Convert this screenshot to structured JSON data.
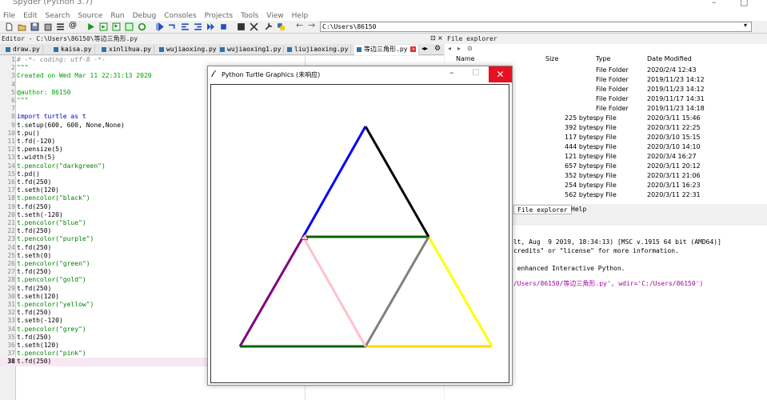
{
  "window": {
    "title": "Spyder (Python 3.7)"
  },
  "menu": [
    "File",
    "Edit",
    "Search",
    "Source",
    "Run",
    "Debug",
    "Consoles",
    "Projects",
    "Tools",
    "View",
    "Help"
  ],
  "toolbar": {
    "path": "C:\\Users\\86150"
  },
  "editor": {
    "pane_title": "Editor - C:\\Users\\86150\\等边三角形.py",
    "tabs": [
      "draw.py",
      "kaisa.py",
      "xinlihua.py",
      "wujiaoxing.py",
      "wujiaoxing1.py",
      "liujiaoxing.py",
      "等边三角形.py"
    ],
    "lines": [
      {
        "n": "1",
        "t": "# -*- coding: utf-8 -*-",
        "k": "comment"
      },
      {
        "n": "2",
        "t": "\"\"\"",
        "k": "doc"
      },
      {
        "n": "3",
        "t": "Created on Wed Mar 11 22:31:13 2020",
        "k": "doc"
      },
      {
        "n": "4",
        "t": "",
        "k": "doc"
      },
      {
        "n": "5",
        "t": "@author: 86150",
        "k": "doc"
      },
      {
        "n": "6",
        "t": "\"\"\"",
        "k": "doc"
      },
      {
        "n": "7",
        "t": "",
        "k": "def"
      },
      {
        "n": "8",
        "t": "import turtle as t",
        "k": "kw"
      },
      {
        "n": "9",
        "t": "t.setup(600, 600, None,None)",
        "k": "def"
      },
      {
        "n": "10",
        "t": "t.pu()",
        "k": "def"
      },
      {
        "n": "11",
        "t": "t.fd(-120)",
        "k": "def"
      },
      {
        "n": "12",
        "t": "t.pensize(5)",
        "k": "def"
      },
      {
        "n": "13",
        "t": "t.width(5)",
        "k": "def"
      },
      {
        "n": "14",
        "t": "t.pencolor(\"darkgreen\")",
        "k": "str"
      },
      {
        "n": "15",
        "t": "t.pd()",
        "k": "def"
      },
      {
        "n": "16",
        "t": "t.fd(250)",
        "k": "def"
      },
      {
        "n": "17",
        "t": "t.seth(120)",
        "k": "def"
      },
      {
        "n": "18",
        "t": "t.pencolor(\"black\")",
        "k": "str"
      },
      {
        "n": "19",
        "t": "t.fd(250)",
        "k": "def"
      },
      {
        "n": "20",
        "t": "t.seth(-120)",
        "k": "def"
      },
      {
        "n": "21",
        "t": "t.pencolor(\"blue\")",
        "k": "str"
      },
      {
        "n": "22",
        "t": "t.fd(250)",
        "k": "def"
      },
      {
        "n": "23",
        "t": "t.pencolor(\"purple\")",
        "k": "str"
      },
      {
        "n": "24",
        "t": "t.fd(250)",
        "k": "def"
      },
      {
        "n": "25",
        "t": "t.seth(0)",
        "k": "def"
      },
      {
        "n": "26",
        "t": "t.pencolor(\"green\")",
        "k": "str"
      },
      {
        "n": "27",
        "t": "t.fd(250)",
        "k": "def"
      },
      {
        "n": "28",
        "t": "t.pencolor(\"gold\")",
        "k": "str"
      },
      {
        "n": "29",
        "t": "t.fd(250)",
        "k": "def"
      },
      {
        "n": "30",
        "t": "t.seth(120)",
        "k": "def"
      },
      {
        "n": "31",
        "t": "t.pencolor(\"yellow\")",
        "k": "str"
      },
      {
        "n": "32",
        "t": "t.fd(250)",
        "k": "def"
      },
      {
        "n": "33",
        "t": "t.seth(-120)",
        "k": "def"
      },
      {
        "n": "34",
        "t": "t.pencolor(\"grey\")",
        "k": "str"
      },
      {
        "n": "35",
        "t": "t.fd(250)",
        "k": "def"
      },
      {
        "n": "36",
        "t": "t.seth(120)",
        "k": "def"
      },
      {
        "n": "37",
        "t": "t.pencolor(\"pink\")",
        "k": "str"
      },
      {
        "n": "38",
        "t": "t.fd(250)",
        "k": "def"
      }
    ]
  },
  "turtle_window": {
    "title": "Python Turtle Graphics (未响应)",
    "segments": [
      {
        "color": "#006400"
      },
      {
        "color": "#000000"
      },
      {
        "color": "#0000ff"
      },
      {
        "color": "#800080"
      },
      {
        "color": "#006400"
      },
      {
        "color": "#ffd700"
      },
      {
        "color": "#ffff00"
      },
      {
        "color": "#808080"
      },
      {
        "color": "#ffc0cb"
      }
    ]
  },
  "file_explorer": {
    "pane_title": "File explorer",
    "headers": [
      "Name",
      "Size",
      "Type",
      "Date Modified"
    ],
    "rows": [
      {
        "size": "",
        "type": "File Folder",
        "date": "2020/2/4 12:43"
      },
      {
        "size": "",
        "type": "File Folder",
        "date": "2019/11/23 14:12"
      },
      {
        "size": "",
        "type": "File Folder",
        "date": "2019/11/23 14:12"
      },
      {
        "size": "",
        "type": "File Folder",
        "date": "2019/11/17 14:31"
      },
      {
        "size": "",
        "type": "File Folder",
        "date": "2019/11/23 14:18"
      },
      {
        "size": "225 bytes",
        "type": "py File",
        "date": "2020/3/11 15:46"
      },
      {
        "size": "392 bytes",
        "type": "py File",
        "date": "2020/3/11 22:25"
      },
      {
        "size": "117 bytes",
        "type": "py File",
        "date": "2020/3/10 15:15"
      },
      {
        "size": "444 bytes",
        "type": "py File",
        "date": "2020/3/10 14:10"
      },
      {
        "size": "121 bytes",
        "type": "py File",
        "date": "2020/3/4 16:27"
      },
      {
        "size": "657 bytes",
        "type": "py File",
        "date": "2020/3/11 20:12"
      },
      {
        "size": "352 bytes",
        "type": "py File",
        "date": "2020/3/11 21:06"
      },
      {
        "size": "254 bytes",
        "type": "py File",
        "date": "2020/3/11 16:23"
      },
      {
        "size": "562 bytes",
        "type": "py File",
        "date": "2020/3/11 22:31"
      }
    ]
  },
  "bottom_tabs": [
    "File explorer",
    "Help"
  ],
  "console": {
    "lines": [
      "ult, Aug  9 2019, 18:34:13) [MSC v.1915 64 bit (AMD64)]",
      "\"credits\" or \"license\" for more information.",
      "",
      "n enhanced Interactive Python.",
      "",
      ":/Users/86150/等边三角形.py', wdir='C:/Users/86150')"
    ]
  }
}
